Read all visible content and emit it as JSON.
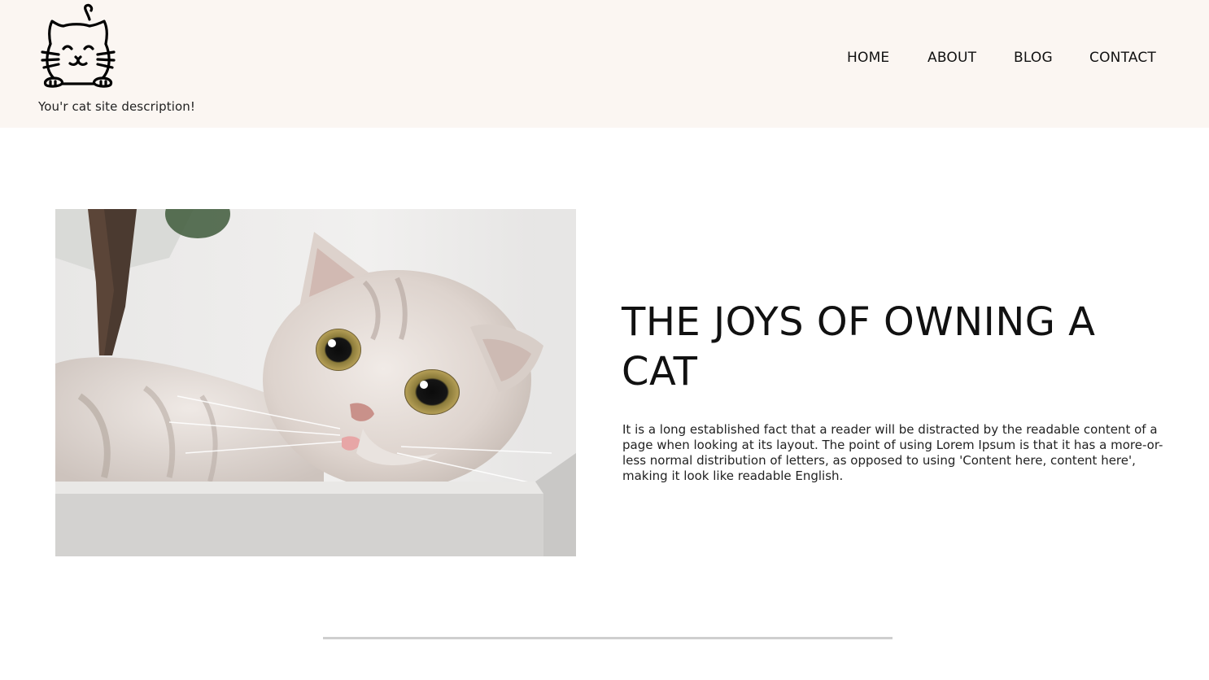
{
  "header": {
    "logo_icon": "cat-face-icon",
    "site_description": "You'r cat site description!",
    "nav": {
      "home": "HOME",
      "about": "ABOUT",
      "blog": "BLOG",
      "contact": "CONTACT"
    }
  },
  "hero": {
    "image_icon": "cat-photo",
    "title": "THE JOYS OF OWNING A CAT",
    "body": "It is a long established fact that a reader will be distracted by the readable content of a page when looking at its layout. The point of using Lorem Ipsum is that it has a more-or-less normal distribution of letters, as opposed to using 'Content here, content here', making it look like readable English."
  },
  "colors": {
    "header_background": "#fbf6f2",
    "page_background": "#ffffff",
    "text": "#111111",
    "divider": "#cfcfcf"
  }
}
